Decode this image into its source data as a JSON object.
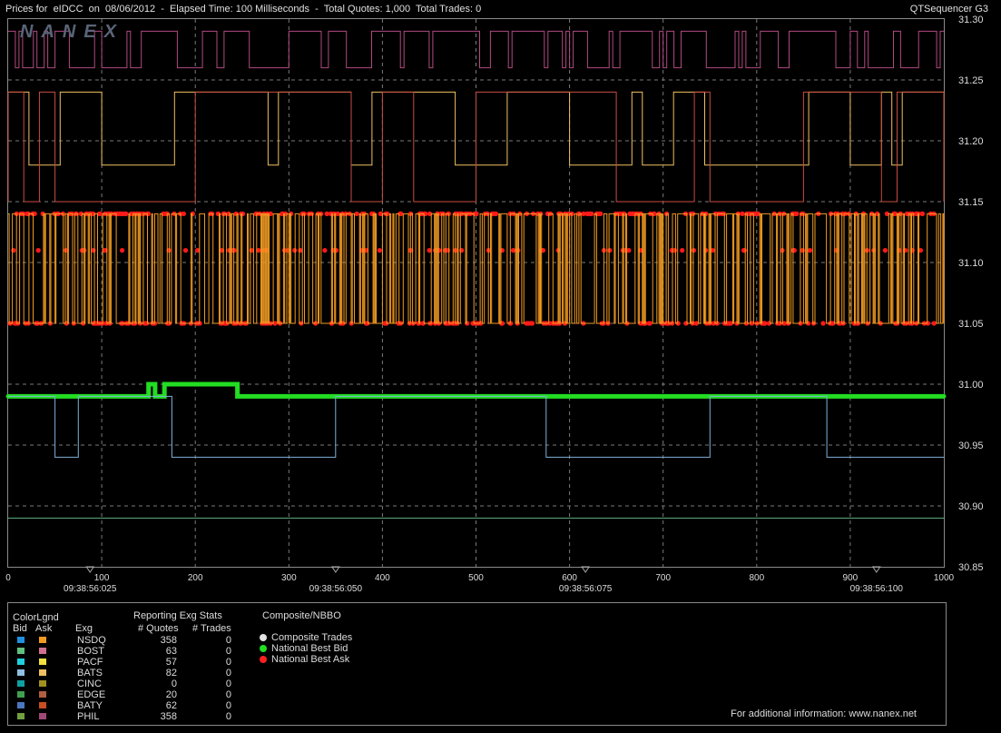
{
  "header": {
    "title": "Prices for  eIDCC  on  08/06/2012  -  Elapsed Time: 100 Milliseconds  -  Total Quotes: 1,000  Total Trades: 0",
    "app_name": "QTSequencer G3",
    "logo_text": "NANEX"
  },
  "chart_data": {
    "type": "line",
    "xlim": [
      0,
      1000
    ],
    "ylim": [
      30.85,
      31.3
    ],
    "x_ticks": [
      0,
      100,
      200,
      300,
      400,
      500,
      600,
      700,
      800,
      900,
      1000
    ],
    "y_ticks": [
      "31.30",
      "31.25",
      "31.20",
      "31.15",
      "31.10",
      "31.05",
      "31.00",
      "30.95",
      "30.90",
      "30.85"
    ],
    "time_labels": [
      {
        "x": 87.5,
        "label": "09:38:56:025"
      },
      {
        "x": 350,
        "label": "09:38:56:050"
      },
      {
        "x": 617,
        "label": "09:38:56:075"
      },
      {
        "x": 928,
        "label": "09:38:56:100"
      }
    ],
    "grid": true,
    "series": [
      {
        "name": "National Best Ask",
        "color": "#ff1a1a",
        "levels": [
          31.14,
          31.11,
          31.05
        ]
      },
      {
        "name": "National Best Bid",
        "color": "#22dd22",
        "points": [
          [
            0,
            30.99
          ],
          [
            150,
            30.99
          ],
          [
            150,
            31.0
          ],
          [
            157,
            31.0
          ],
          [
            157,
            30.99
          ],
          [
            167,
            30.99
          ],
          [
            167,
            31.0
          ],
          [
            245,
            31.0
          ],
          [
            245,
            30.99
          ],
          [
            1000,
            30.99
          ]
        ]
      },
      {
        "name": "PHIL Ask",
        "color": "#b04a80",
        "levels": [
          31.29,
          31.26
        ]
      },
      {
        "name": "PACF Ask",
        "color": "#f0c060",
        "levels": [
          31.24,
          31.18
        ]
      },
      {
        "name": "BATY Ask",
        "color": "#c84e40",
        "levels": [
          31.15,
          31.24
        ]
      },
      {
        "name": "NSDQ Ask",
        "color": "#f09a20",
        "levels": [
          31.14,
          31.05
        ]
      },
      {
        "name": "BATS Bid",
        "color": "#80b0d8",
        "levels": [
          30.99,
          30.94
        ]
      },
      {
        "name": "BOST Bid",
        "color": "#60b080",
        "levels": [
          30.89
        ]
      }
    ]
  },
  "legend": {
    "color_legend_title": "ColorLgnd",
    "bid_header": "Bid",
    "ask_header": "Ask",
    "stats_title": "Reporting Exg Stats",
    "exg_header": "Exg",
    "quotes_header": "# Quotes",
    "trades_header": "# Trades",
    "composite_title": "Composite/NBBO",
    "rows": [
      {
        "exg": "NSDQ",
        "quotes": "358",
        "trades": "0",
        "bid_color": "#1e90e0",
        "ask_color": "#f09a20"
      },
      {
        "exg": "BOST",
        "quotes": "63",
        "trades": "0",
        "bid_color": "#60c080",
        "ask_color": "#d07090"
      },
      {
        "exg": "PACF",
        "quotes": "57",
        "trades": "0",
        "bid_color": "#20d0e0",
        "ask_color": "#f0e040"
      },
      {
        "exg": "BATS",
        "quotes": "82",
        "trades": "0",
        "bid_color": "#90c0e0",
        "ask_color": "#f0c060"
      },
      {
        "exg": "CINC",
        "quotes": "0",
        "trades": "0",
        "bid_color": "#10a0a0",
        "ask_color": "#a09020"
      },
      {
        "exg": "EDGE",
        "quotes": "20",
        "trades": "0",
        "bid_color": "#40a050",
        "ask_color": "#b06040"
      },
      {
        "exg": "BATY",
        "quotes": "62",
        "trades": "0",
        "bid_color": "#4a78c0",
        "ask_color": "#c84e20"
      },
      {
        "exg": "PHIL",
        "quotes": "358",
        "trades": "0",
        "bid_color": "#70a040",
        "ask_color": "#a04878"
      }
    ],
    "composite_items": [
      {
        "label": "Composite Trades",
        "color": "#e0e0e0"
      },
      {
        "label": "National Best Bid",
        "color": "#22dd22"
      },
      {
        "label": "National Best Ask",
        "color": "#ff2020"
      }
    ],
    "footer": "For additional information: www.nanex.net"
  }
}
